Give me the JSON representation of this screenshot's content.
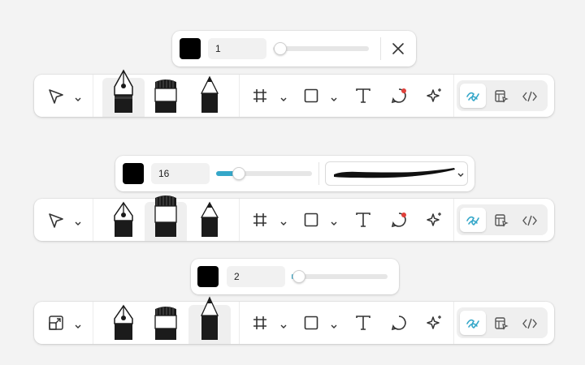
{
  "popover1": {
    "stroke_width": "1",
    "close_label": "×",
    "slider_value": 0.0
  },
  "popover2": {
    "stroke_width": "16",
    "slider_value": 0.28,
    "stroke_style": "brush-stroke"
  },
  "popover3": {
    "stroke_width": "2",
    "slider_value": 0.0
  },
  "colors": {
    "swatch": "#000000",
    "accent": "#35a7c9",
    "notification": "#e0413b"
  },
  "toolbar1": {
    "tool_icon": "pointer-icon",
    "active_pen": "fountain-pen",
    "comment_has_badge": true
  },
  "toolbar2": {
    "tool_icon": "pointer-icon",
    "active_pen": "brush-pen",
    "comment_has_badge": true
  },
  "toolbar3": {
    "tool_icon": "resize-icon",
    "active_pen": "pencil",
    "comment_has_badge": false
  },
  "modes": [
    "draw-mode",
    "design-mode",
    "dev-mode"
  ]
}
